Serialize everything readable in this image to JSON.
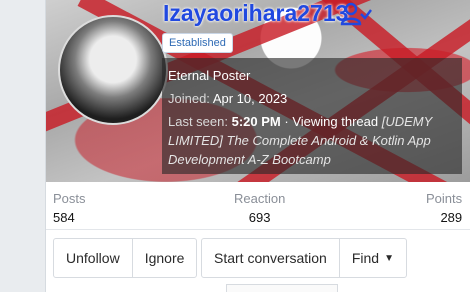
{
  "profile": {
    "username": "Izayaorihara2713",
    "follow_icon": "user-check-icon",
    "badge": "Established",
    "title": "Eternal Poster",
    "joined_label": "Joined:",
    "joined_value": "Apr 10, 2023",
    "last_seen_label": "Last seen:",
    "last_seen_time": "5:20 PM",
    "last_seen_activity": "· Viewing thread",
    "last_seen_thread": "[UDEMY LIMITED] The Complete Android & Kotlin App Development A-Z Bootcamp"
  },
  "stats": {
    "posts_label": "Posts",
    "posts_value": "584",
    "reaction_label": "Reaction",
    "reaction_value": "693",
    "points_label": "Points",
    "points_value": "289"
  },
  "actions": {
    "unfollow": "Unfollow",
    "ignore": "Ignore",
    "start_conversation": "Start conversation",
    "find": "Find",
    "find_icon": "caret-down-icon"
  },
  "colors": {
    "username": "#2149e0",
    "badge_text": "#2f6bb5",
    "banner_accent": "#c81c26"
  }
}
